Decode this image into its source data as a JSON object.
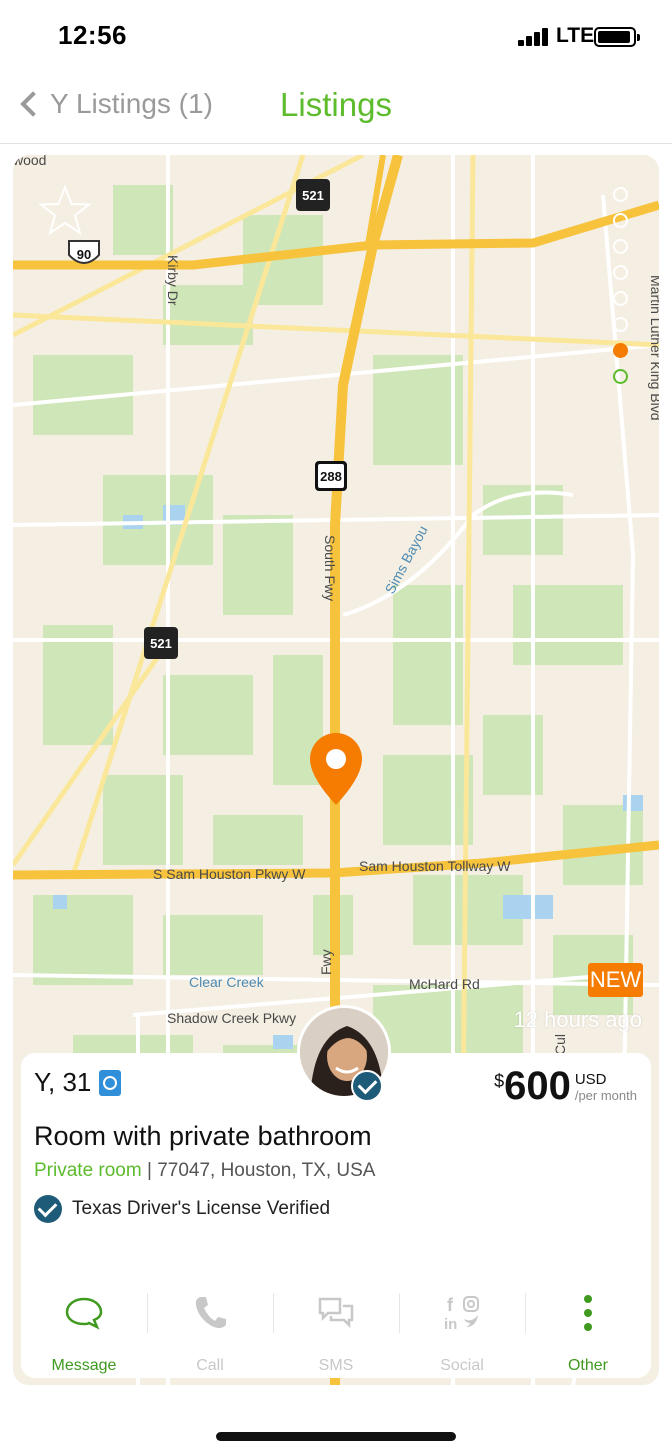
{
  "status": {
    "time": "12:56",
    "network": "LTE"
  },
  "nav": {
    "back_label": "Y Listings (1)",
    "title": "Listings"
  },
  "map": {
    "road_labels": {
      "sam_houston": "Sam Houston Tollway W",
      "s_sam_houston": "S Sam Houston Pkwy W",
      "south_fwy": "South Fwy",
      "sims_bayou": "Sims Bayou",
      "kirby": "Kirby Dr",
      "clear_creek": "Clear Creek",
      "shadow_creek": "Shadow Creek Pkwy",
      "mchard": "McHard Rd",
      "mlk": "Martin Luther King Blvd",
      "fwy": "Fwy",
      "cul": "Cul",
      "wood": "wood"
    },
    "shields": {
      "us90": "90",
      "tx288": "288",
      "fm521_top": "521",
      "fm521_left": "521"
    },
    "photo_indicator": {
      "count": 8,
      "active_index": 6
    },
    "badge_new": "NEW",
    "posted_ago": "12 hours ago",
    "colors": {
      "land": "#f4efe2",
      "green": "#cfe6b8",
      "highway": "#f7c23c",
      "water": "#a9d3ee",
      "pin": "#f57c00"
    }
  },
  "listing": {
    "host_name": "Y, 31",
    "price_symbol": "$",
    "price_amount": "600",
    "price_currency": "USD",
    "price_period": "/per month",
    "title": "Room with private bathroom",
    "room_type": "Private room",
    "location": " | 77047, Houston, TX, USA",
    "verification": "Texas Driver's License Verified"
  },
  "actions": [
    {
      "label": "Message",
      "icon": "message-bubble-icon",
      "enabled": true
    },
    {
      "label": "Call",
      "icon": "phone-icon",
      "enabled": false
    },
    {
      "label": "SMS",
      "icon": "sms-bubbles-icon",
      "enabled": false
    },
    {
      "label": "Social",
      "icon": "social-grid-icon",
      "enabled": false
    },
    {
      "label": "Other",
      "icon": "more-vertical-icon",
      "enabled": true
    }
  ]
}
